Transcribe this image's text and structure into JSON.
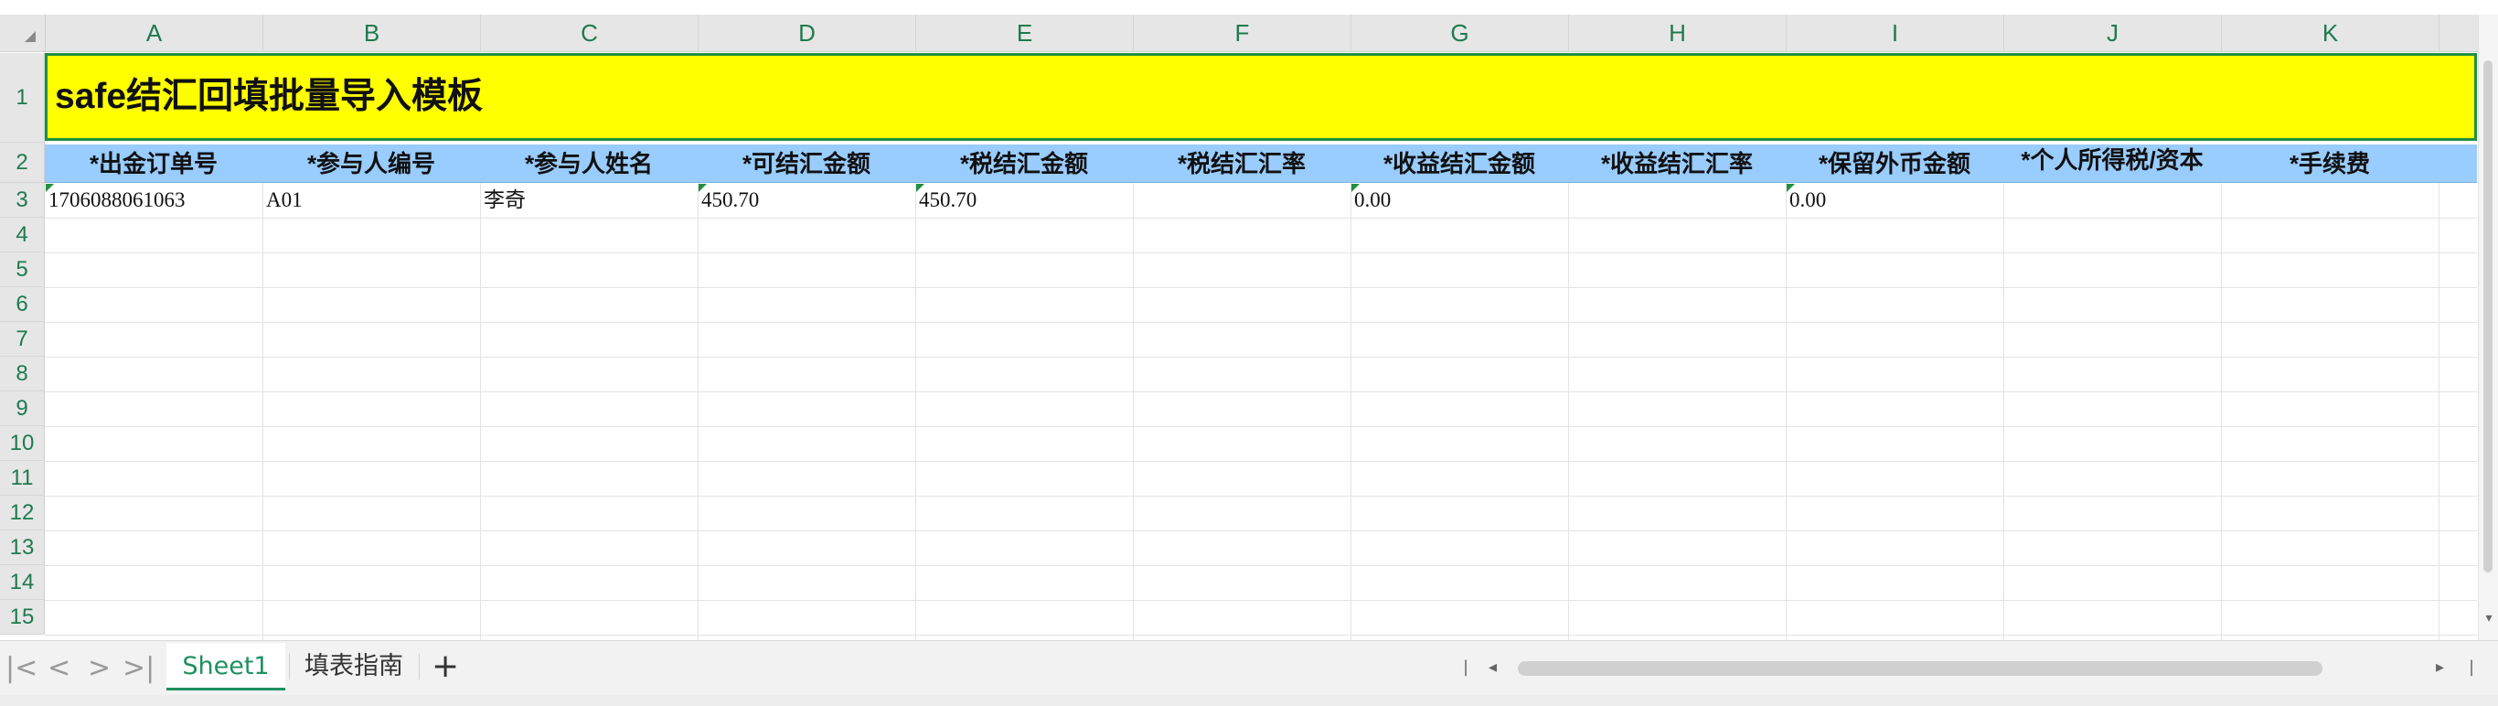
{
  "columns": [
    "A",
    "B",
    "C",
    "D",
    "E",
    "F",
    "G",
    "H",
    "I",
    "J",
    "K"
  ],
  "rows": [
    "1",
    "2",
    "3",
    "4",
    "5",
    "6",
    "7",
    "8",
    "9",
    "10",
    "11",
    "12",
    "13",
    "14",
    "15"
  ],
  "title": "safe结汇回填批量导入模板",
  "headers": [
    "*出金订单号",
    "*参与人编号",
    "*参与人姓名",
    "*可结汇金额",
    "*税结汇金额",
    "*税结汇汇率",
    "*收益结汇金额",
    "*收益结汇汇率",
    "*保留外币金额",
    "*个人所得税/资本",
    "*手续费"
  ],
  "data_row": [
    "1706088061063",
    "A01",
    "李奇",
    "450.70",
    "450.70",
    "",
    "0.00",
    "",
    "0.00",
    "",
    ""
  ],
  "tabs": {
    "sheet1": "Sheet1",
    "sheet2": "填表指南"
  },
  "nav": {
    "first": "|<",
    "prev": "<",
    "next": ">",
    "last": ">|",
    "add": "+"
  },
  "colors": {
    "title_bg": "#ffff00",
    "header_bg": "#99ccff",
    "accent": "#1e9060"
  }
}
